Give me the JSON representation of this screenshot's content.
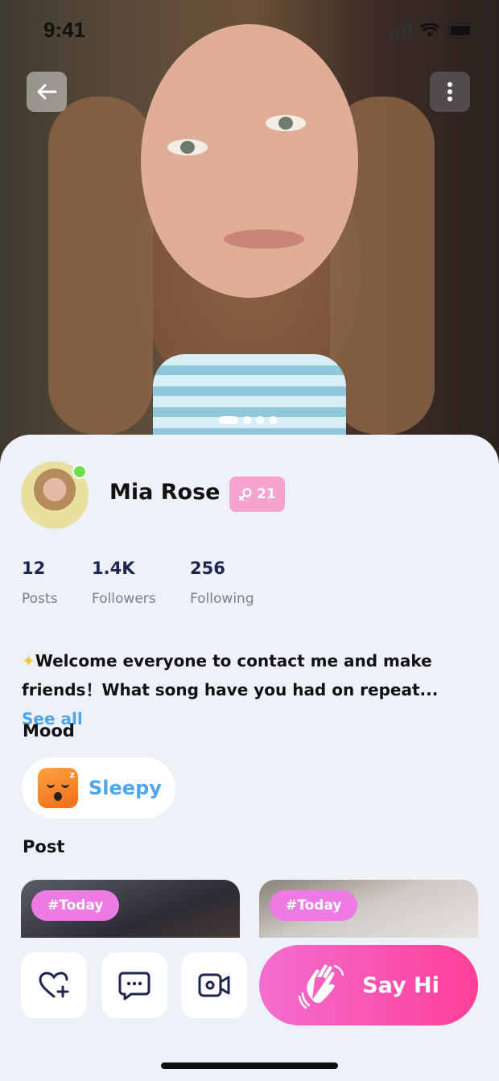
{
  "status_bar": {
    "time": "9:41"
  },
  "photo": {
    "page_count": 4,
    "active_page": 1
  },
  "profile": {
    "name": "Mia Rose",
    "online": true,
    "badge": {
      "icon": "female-icon",
      "value": "21",
      "color": "#f5a3cf"
    }
  },
  "stats": [
    {
      "value": "12",
      "label": "Posts"
    },
    {
      "value": "1.4K",
      "label": "Followers"
    },
    {
      "value": "256",
      "label": "Following"
    }
  ],
  "bio": {
    "text": "Welcome everyone to contact me and make friends！What song have you had on repeat...",
    "see_all": "See all"
  },
  "mood": {
    "title": "Mood",
    "icon": "sleepy-face-icon",
    "label": "Sleepy"
  },
  "posts": {
    "title": "Post",
    "items": [
      {
        "tag": "#Today"
      },
      {
        "tag": "#Today"
      }
    ]
  },
  "actions": {
    "like_icon": "heart-plus-icon",
    "message_icon": "chat-bubble-icon",
    "video_icon": "video-camera-icon",
    "say_hi": "Say Hi"
  },
  "colors": {
    "accent_blue": "#4ea5ee",
    "say_hi_start": "#f26ed0",
    "say_hi_end": "#ff3f98",
    "tag_pink": "#ee7be4"
  }
}
